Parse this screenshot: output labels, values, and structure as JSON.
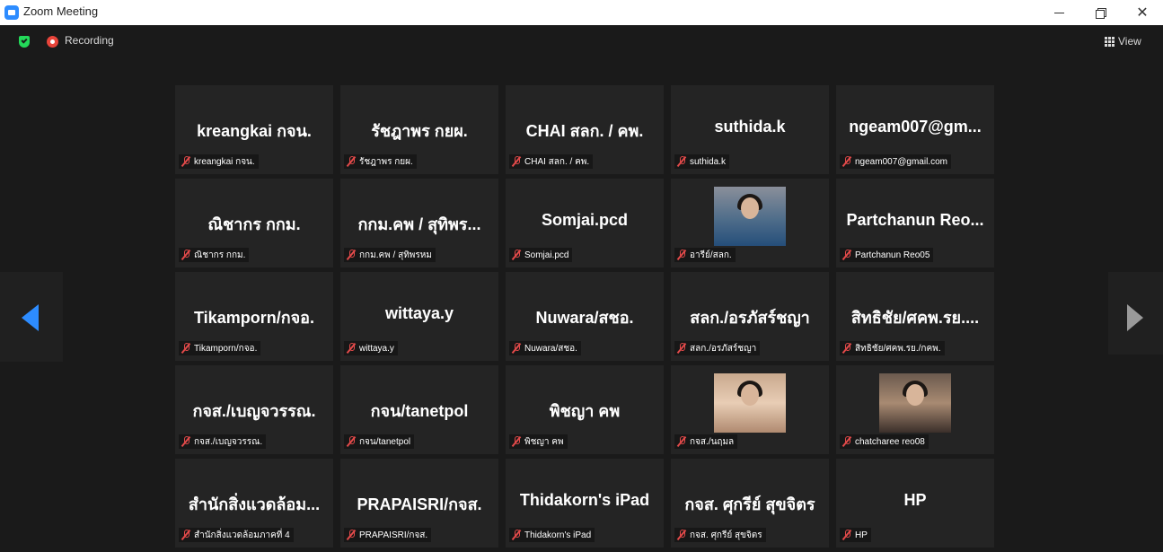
{
  "window": {
    "title": "Zoom Meeting",
    "icon": "zoom-app-icon",
    "controls": [
      "minimize",
      "restore",
      "close"
    ]
  },
  "topbar": {
    "recording_label": "Recording",
    "view_label": "View"
  },
  "navigation": {
    "prev_icon": "chevron-left-icon",
    "next_icon": "chevron-right-icon",
    "accent_color": "#2d8cff"
  },
  "participants": [
    {
      "display": "kreangkai กจน.",
      "name": "kreangkai กจน.",
      "muted": true,
      "video": false
    },
    {
      "display": "รัชฎาพร กยผ.",
      "name": "รัชฎาพร กยผ.",
      "muted": true,
      "video": false
    },
    {
      "display": "CHAI สลก. / คพ.",
      "name": "CHAI สลก. / คพ.",
      "muted": true,
      "video": false
    },
    {
      "display": "suthida.k",
      "name": "suthida.k",
      "muted": true,
      "video": false
    },
    {
      "display": "ngeam007@gm...",
      "name": "ngeam007@gmail.com",
      "muted": true,
      "video": false
    },
    {
      "display": "ณิชากร กกม.",
      "name": "ณิชากร กกม.",
      "muted": true,
      "video": false
    },
    {
      "display": "กกม.คพ / สุทิพร...",
      "name": "กกม.คพ / สุทิพรหม",
      "muted": true,
      "video": false
    },
    {
      "display": "Somjai.pcd",
      "name": "Somjai.pcd",
      "muted": true,
      "video": false
    },
    {
      "display": "",
      "name": "อารีย์/สลก.",
      "muted": true,
      "video": true
    },
    {
      "display": "Partchanun Reo...",
      "name": "Partchanun Reo05",
      "muted": true,
      "video": false
    },
    {
      "display": "Tikamporn/กจอ.",
      "name": "Tikamporn/กจอ.",
      "muted": true,
      "video": false
    },
    {
      "display": "wittaya.y",
      "name": "wittaya.y",
      "muted": true,
      "video": false
    },
    {
      "display": "Nuwara/สชอ.",
      "name": "Nuwara/สชอ.",
      "muted": true,
      "video": false
    },
    {
      "display": "สลก./อรภัสร์ชญา",
      "name": "สลก./อรภัสร์ชญา",
      "muted": true,
      "video": false
    },
    {
      "display": "สิทธิชัย/ศคพ.รย....",
      "name": "สิทธิชัย/ศคพ.รย./กคพ.",
      "muted": true,
      "video": false
    },
    {
      "display": "กจส./เบญจวรรณ.",
      "name": "กจส./เบญจวรรณ.",
      "muted": true,
      "video": false
    },
    {
      "display": "กจน/tanetpol",
      "name": "กจน/tanetpol",
      "muted": true,
      "video": false
    },
    {
      "display": "พิชญา คพ",
      "name": "พิชญา คพ",
      "muted": true,
      "video": false
    },
    {
      "display": "",
      "name": "กจส./นฤมล",
      "muted": true,
      "video": true
    },
    {
      "display": "",
      "name": "chatcharee reo08",
      "muted": true,
      "video": true
    },
    {
      "display": "สำนักสิ่งแวดล้อม...",
      "name": "สำนักสิ่งแวดล้อมภาคที่ 4",
      "muted": true,
      "video": false
    },
    {
      "display": "PRAPAISRI/กจส.",
      "name": "PRAPAISRI/กจส.",
      "muted": true,
      "video": false
    },
    {
      "display": "Thidakorn's iPad",
      "name": "Thidakorn's iPad",
      "muted": true,
      "video": false
    },
    {
      "display": "กจส. ศุกรีย์ สุขจิตร",
      "name": "กจส. ศุกรีย์ สุขจิตร",
      "muted": true,
      "video": false
    },
    {
      "display": "HP",
      "name": "HP",
      "muted": true,
      "video": false
    }
  ]
}
